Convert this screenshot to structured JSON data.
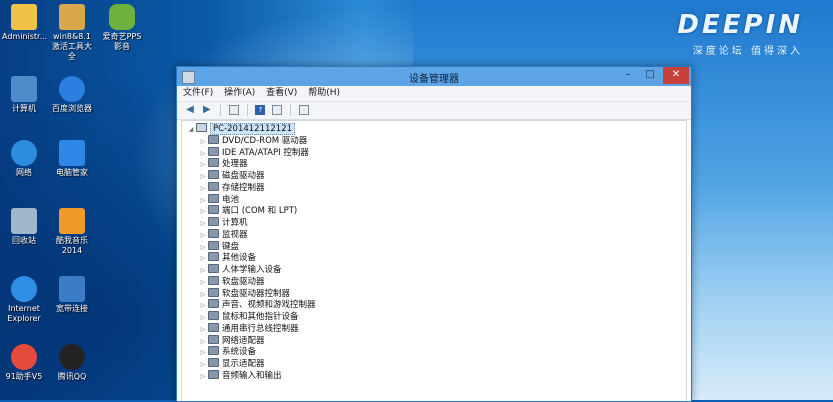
{
  "desktop": {
    "brand": {
      "logo": "DEEPIN",
      "slogan": "深度论坛  值得深入"
    },
    "icons": [
      {
        "label": "Administr...",
        "color": "#f0c24a"
      },
      {
        "label": "win8&8.1激活工具大全",
        "color": "#d9a64a"
      },
      {
        "label": "爱奇艺PPS影音",
        "color": "#6fb13c"
      },
      {
        "label": "计算机",
        "color": "#4d8bc9"
      },
      {
        "label": "百度浏览器",
        "color": "#2a7fe0"
      },
      {
        "label": "网络",
        "color": "#2c8de0"
      },
      {
        "label": "电脑管家",
        "color": "#2e86e6"
      },
      {
        "label": "回收站",
        "color": "#9fb7cc"
      },
      {
        "label": "酷我音乐2014",
        "color": "#f09a2a"
      },
      {
        "label": "Internet Explorer",
        "color": "#2f8fe6"
      },
      {
        "label": "宽带连接",
        "color": "#3a7dc6"
      },
      {
        "label": "91助手V5",
        "color": "#e64a3a"
      },
      {
        "label": "腾讯QQ",
        "color": "#222222"
      }
    ]
  },
  "window": {
    "title": "设备管理器",
    "controls": {
      "minimize": "–",
      "maximize": "□",
      "close": "✕"
    },
    "menu": [
      "文件(F)",
      "操作(A)",
      "查看(V)",
      "帮助(H)"
    ],
    "root": "PC-201412112121",
    "devices": [
      "DVD/CD-ROM 驱动器",
      "IDE ATA/ATAPI 控制器",
      "处理器",
      "磁盘驱动器",
      "存储控制器",
      "电池",
      "端口 (COM 和 LPT)",
      "计算机",
      "监视器",
      "键盘",
      "其他设备",
      "人体学输入设备",
      "软盘驱动器",
      "软盘驱动器控制器",
      "声音、视频和游戏控制器",
      "鼠标和其他指针设备",
      "通用串行总线控制器",
      "网络适配器",
      "系统设备",
      "显示适配器",
      "音频输入和输出"
    ]
  }
}
